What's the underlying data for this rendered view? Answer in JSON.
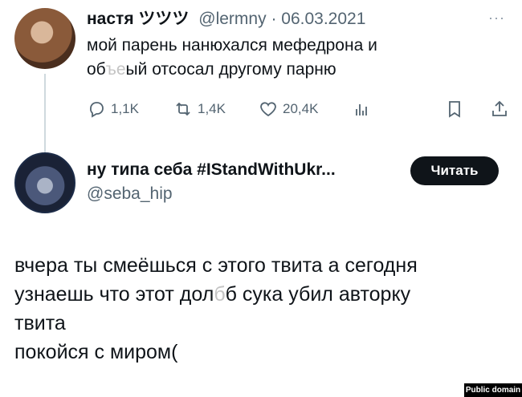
{
  "tweet1": {
    "name": "настя ツツツ",
    "handle": "@lermny",
    "separator": "·",
    "date": "06.03.2021",
    "more": "···",
    "text_lines": [
      {
        "before": "мой парень нанюхался мефедрона и",
        "redacted": "",
        "after": ""
      },
      {
        "before": "об",
        "redacted": "ъе ",
        "after": "ый отсосал другому парню"
      }
    ],
    "replies": "1,1K",
    "retweets": "1,4K",
    "likes": "20,4K"
  },
  "tweet2": {
    "name": "ну типа себа #IStandWithUkr...",
    "handle": "@seba_hip",
    "follow_button": "Читать",
    "text_lines": [
      {
        "before": "вчера ты смеёшься с этого твита а сегодня",
        "redacted": "",
        "after": ""
      },
      {
        "before": "узнаешь что этот дол",
        "redacted": "б   ",
        "after": "б сука убил авторку"
      },
      {
        "before": "твита",
        "redacted": "",
        "after": ""
      },
      {
        "before": "покойся с миром(",
        "redacted": "",
        "after": ""
      }
    ]
  },
  "badge": "Public domain",
  "colors": {
    "text": "#0f1419",
    "secondary": "#536471",
    "button_bg": "#0f1419",
    "thread_line": "#cfd9de"
  }
}
